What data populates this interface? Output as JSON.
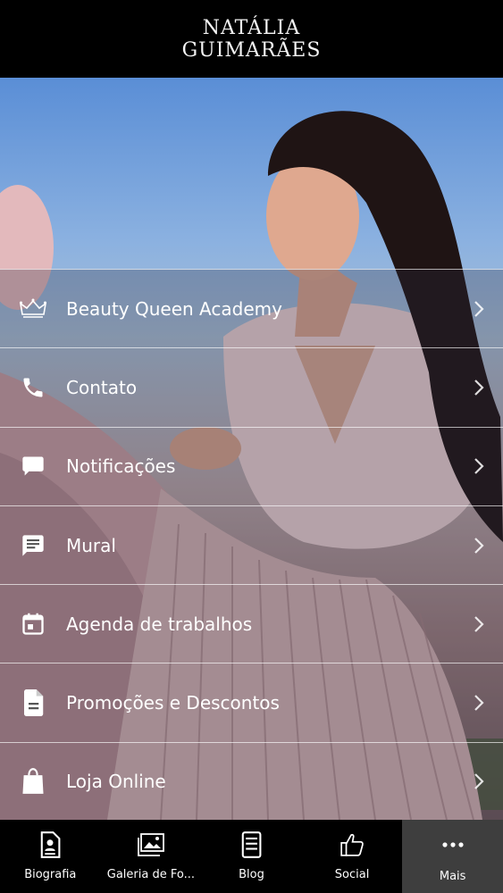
{
  "header": {
    "logo_line1": "NATÁLIA",
    "logo_line2": "GUIMARÃES"
  },
  "menu": {
    "items": [
      {
        "label": "Beauty Queen Academy",
        "icon": "crown-icon"
      },
      {
        "label": "Contato",
        "icon": "phone-icon"
      },
      {
        "label": "Notificações",
        "icon": "chat-bubble-icon"
      },
      {
        "label": "Mural",
        "icon": "message-board-icon"
      },
      {
        "label": "Agenda de trabalhos",
        "icon": "calendar-icon"
      },
      {
        "label": "Promoções e Descontos",
        "icon": "document-icon"
      },
      {
        "label": "Loja Online",
        "icon": "shopping-bag-icon"
      }
    ]
  },
  "tabbar": {
    "tabs": [
      {
        "label": "Biografia",
        "icon": "profile-card-icon",
        "active": false
      },
      {
        "label": "Galeria de Fo...",
        "icon": "gallery-icon",
        "active": false
      },
      {
        "label": "Blog",
        "icon": "blog-icon",
        "active": false
      },
      {
        "label": "Social",
        "icon": "thumbs-up-icon",
        "active": false
      },
      {
        "label": "Mais",
        "icon": "more-dots-icon",
        "active": true
      }
    ]
  },
  "colors": {
    "header_bg": "#000000",
    "tabbar_bg": "#000000",
    "tab_active_bg": "#3e3e3e",
    "text": "#ffffff"
  }
}
